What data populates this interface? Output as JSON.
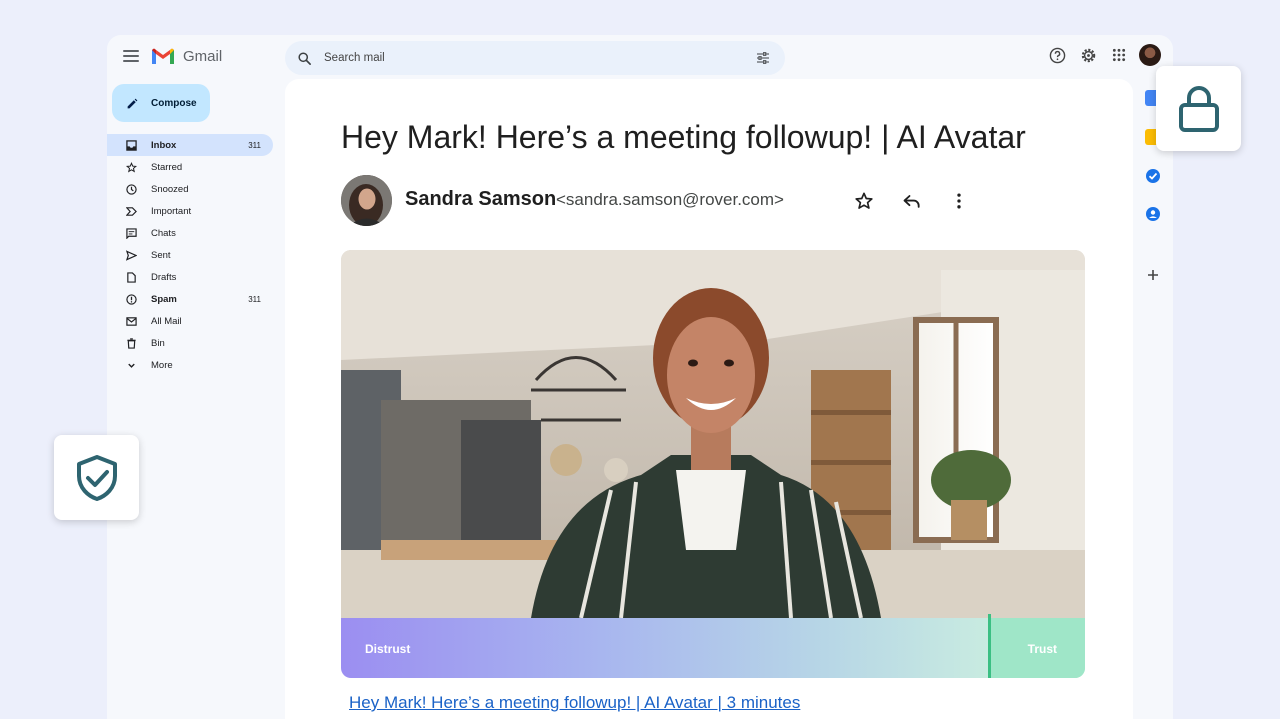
{
  "app": {
    "name": "Gmail"
  },
  "search": {
    "placeholder": "Search mail"
  },
  "compose": {
    "label": "Compose"
  },
  "nav": [
    {
      "label": "Inbox",
      "count": "311",
      "icon": "inbox-icon"
    },
    {
      "label": "Starred",
      "count": "",
      "icon": "star-icon"
    },
    {
      "label": "Snoozed",
      "count": "",
      "icon": "clock-icon"
    },
    {
      "label": "Important",
      "count": "",
      "icon": "important-icon"
    },
    {
      "label": "Chats",
      "count": "",
      "icon": "chat-icon"
    },
    {
      "label": "Sent",
      "count": "",
      "icon": "send-icon"
    },
    {
      "label": "Drafts",
      "count": "",
      "icon": "draft-icon"
    },
    {
      "label": "Spam",
      "count": "311",
      "icon": "spam-icon"
    },
    {
      "label": "All Mail",
      "count": "",
      "icon": "mail-icon"
    },
    {
      "label": "Bin",
      "count": "",
      "icon": "trash-icon"
    },
    {
      "label": "More",
      "count": "",
      "icon": "chevron-down-icon"
    }
  ],
  "email": {
    "subject": "Hey Mark! Here’s a meeting followup! | AI Avatar",
    "sender_name": "Sandra Samson",
    "sender_email": "<sandra.samson@rover.com>",
    "link_text": "Hey Mark! Here’s a meeting followup! | AI Avatar | 3 minutes"
  },
  "trust_meter": {
    "left_label": "Distrust",
    "right_label": "Trust",
    "level": 0.87
  },
  "colors": {
    "accent": "#c2e7ff",
    "active_nav": "#d3e3fd",
    "link": "#1a62c7",
    "trust": "#3bbf83",
    "shield": "#2e6470"
  }
}
